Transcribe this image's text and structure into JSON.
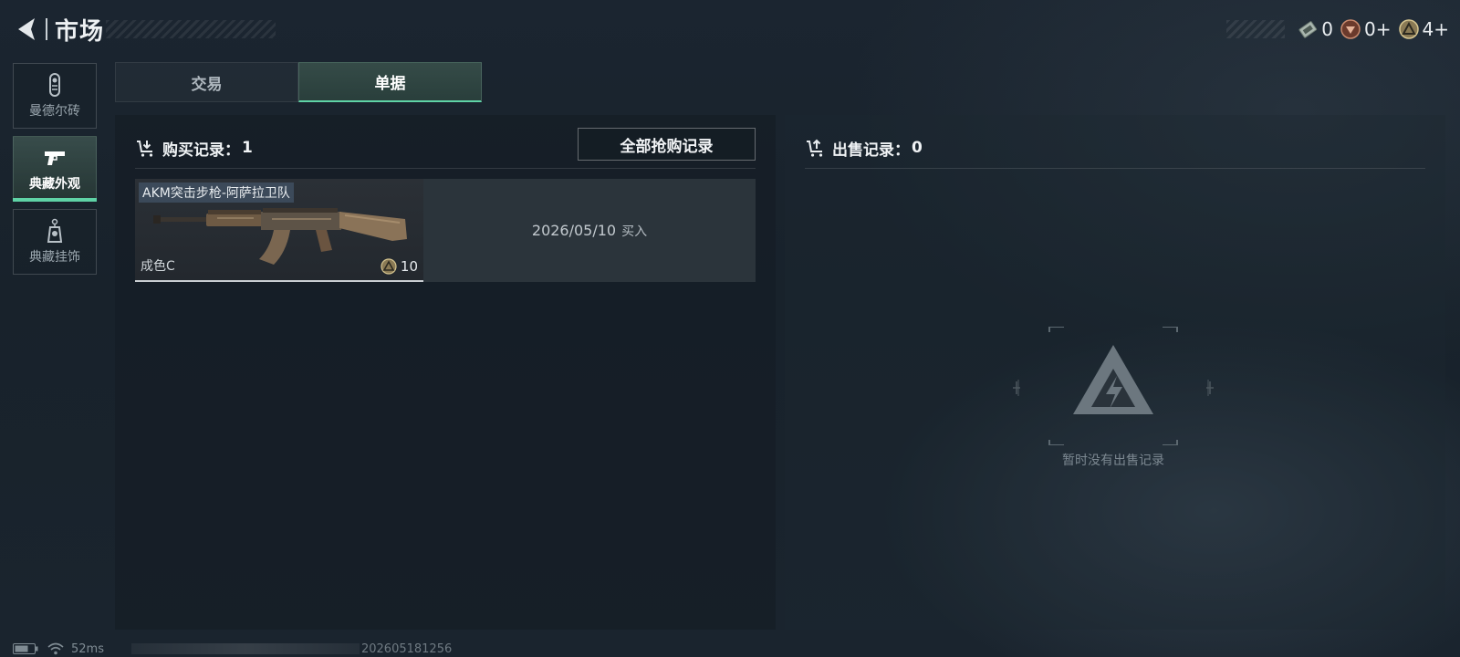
{
  "header": {
    "title": "市场",
    "currencies": [
      {
        "icon": "ticket-icon",
        "value": "0"
      },
      {
        "icon": "gem-token-icon",
        "value": "0+"
      },
      {
        "icon": "coin-token-icon",
        "value": "4+"
      }
    ]
  },
  "sidebar": {
    "items": [
      {
        "label": "曼德尔砖",
        "icon": "brick-icon",
        "active": false
      },
      {
        "label": "典藏外观",
        "icon": "pistol-icon",
        "active": true
      },
      {
        "label": "典藏挂饰",
        "icon": "charm-icon",
        "active": false
      }
    ]
  },
  "tabs": [
    {
      "label": "交易",
      "active": false
    },
    {
      "label": "单据",
      "active": true
    }
  ],
  "purchase": {
    "label": "购买记录：",
    "count": "1",
    "all_button": "全部抢购记录",
    "records": [
      {
        "name": "AKM突击步枪-阿萨拉卫队",
        "grade": "成色C",
        "price": "10",
        "date": "2026/05/10",
        "action": "买入"
      }
    ]
  },
  "sales": {
    "label": "出售记录：",
    "count": "0",
    "empty_text": "暂时没有出售记录"
  },
  "footer": {
    "latency": "52ms",
    "build_id": "202605181256"
  },
  "colors": {
    "accent": "#5fd3a6",
    "background": "#1a242e",
    "panel": "#151d25"
  }
}
